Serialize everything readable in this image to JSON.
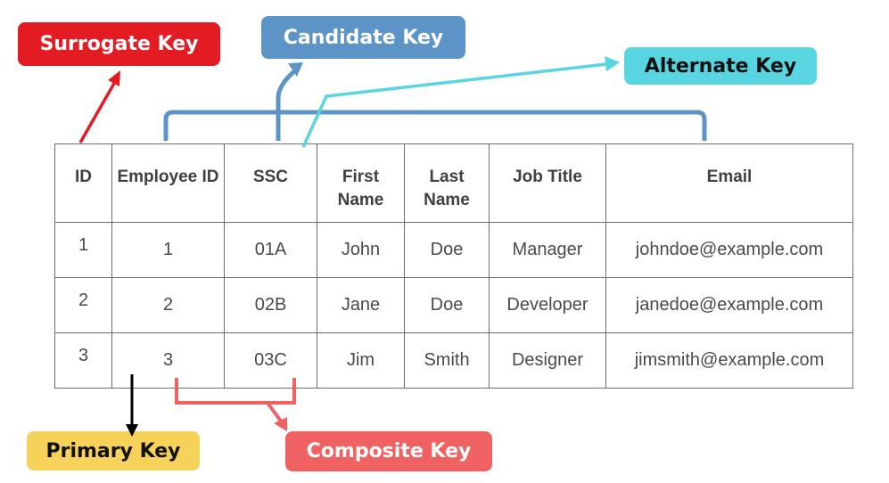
{
  "colors": {
    "surrogate": "#e31b23",
    "candidate": "#5d94c8",
    "alternate": "#58d5e0",
    "primary": "#f6d25a",
    "composite": "#f06161",
    "arrow_primary": "#000000"
  },
  "labels": {
    "surrogate_key": "Surrogate Key",
    "candidate_key": "Candidate Key",
    "alternate_key": "Alternate Key",
    "primary_key": "Primary Key",
    "composite_key": "Composite Key"
  },
  "table": {
    "headers": [
      "ID",
      "Employee ID",
      "SSC",
      "First Name",
      "Last Name",
      "Job Title",
      "Email"
    ],
    "rows": [
      [
        "1",
        "1",
        "01A",
        "John",
        "Doe",
        "Manager",
        "johndoe@example.com"
      ],
      [
        "2",
        "2",
        "02B",
        "Jane",
        "Doe",
        "Developer",
        "janedoe@example.com"
      ],
      [
        "3",
        "3",
        "03C",
        "Jim",
        "Smith",
        "Designer",
        "jimsmith@example.com"
      ]
    ]
  }
}
